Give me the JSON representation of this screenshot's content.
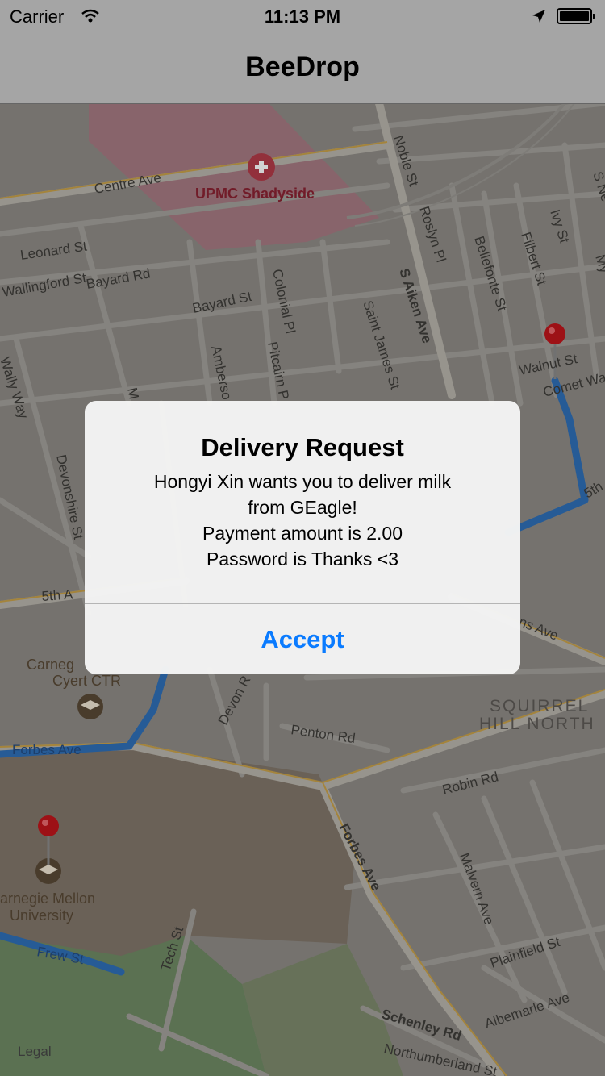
{
  "status": {
    "carrier": "Carrier",
    "time": "11:13 PM"
  },
  "nav": {
    "title": "BeeDrop"
  },
  "map": {
    "labels": {
      "upmc": "UPMC Shadyside",
      "centre": "Centre Ave",
      "leonard": "Leonard St",
      "wallingford": "Wallingford St",
      "bayardrd": "Bayard Rd",
      "bayardst": "Bayard St",
      "colonial": "Colonial Pl",
      "pitcairn": "Pitcairn P",
      "amberson": "Amberso",
      "saintjames": "Saint James St",
      "saiken": "S Aiken Ave",
      "noble": "Noble St",
      "roslyn": "Roslyn Pl",
      "bellefonte": "Bellefonte St",
      "filbert": "Filbert St",
      "ivy": "Ivy St",
      "walnut": "Walnut St",
      "comet": "Comet Wa",
      "sne": "S Ne",
      "my": "My",
      "wally": "Wally Way",
      "devonshire": "Devonshire St",
      "fifthA": "5th A",
      "fifthR": "5th",
      "carnegiecyert1": "Carneg",
      "carnegiecyert2": "Cyert CTR",
      "forbesW": "Forbes Ave",
      "forbesDiag": "Forbes Ave",
      "devon": "Devon R",
      "penton": "Penton Rd",
      "squirrel1": "SQUIRREL",
      "squirrel2": "HILL NORTH",
      "robin": "Robin Rd",
      "malvern": "Malvern Ave",
      "plainfield": "Plainfield St",
      "albemarle": "Albemarle Ave",
      "schenley": "Schenley Rd",
      "northumberland": "Northumberland St",
      "cmu1": "arnegie Mellon",
      "cmu2": "University",
      "frew": "Frew St",
      "tech": "Tech St",
      "nsAve": "ns Ave",
      "m": "M"
    }
  },
  "alert": {
    "title": "Delivery Request",
    "line1": "Hongyi Xin wants you to deliver milk",
    "line2": "from GEagle!",
    "line3": "Payment amount is 2.00",
    "line4": "Password is Thanks <3",
    "button": "Accept"
  },
  "legal": "Legal",
  "colors": {
    "accent": "#0a7bff",
    "route": "#2f6fb8",
    "pin": "#c0151b"
  }
}
